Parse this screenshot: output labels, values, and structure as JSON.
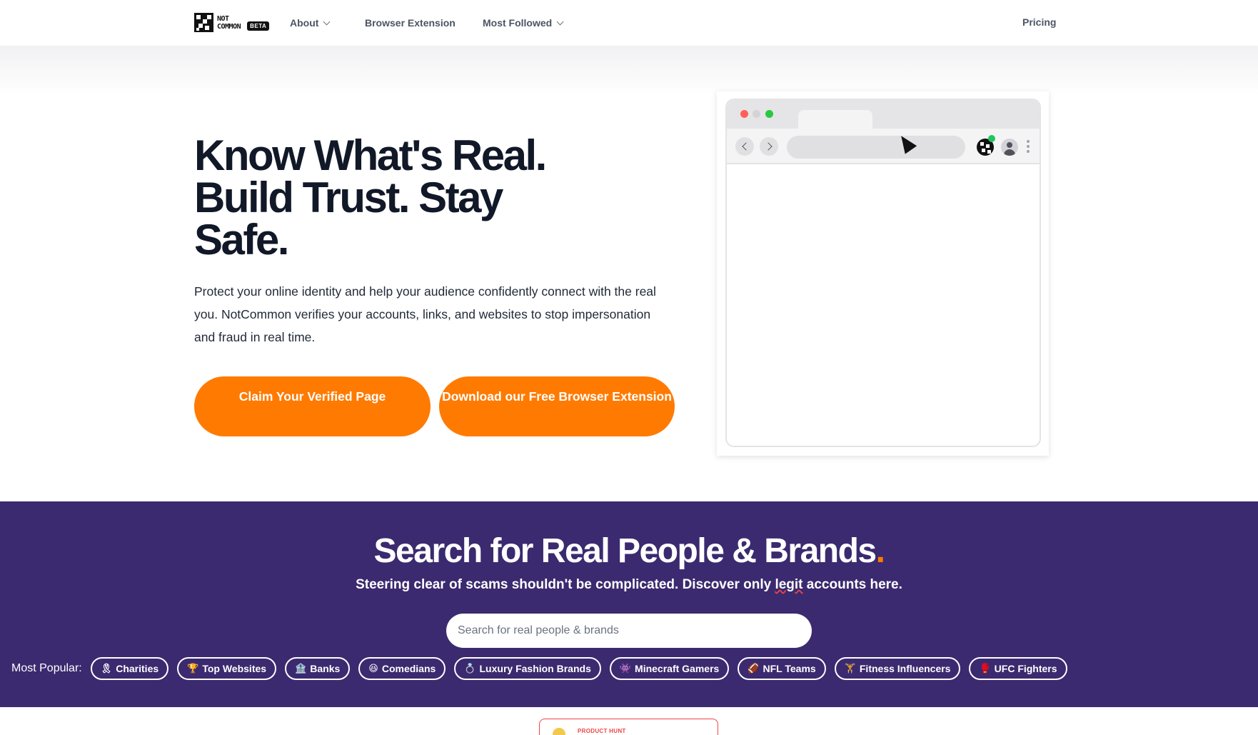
{
  "nav": {
    "logo_line1": "NOT",
    "logo_line2": "COMMON",
    "logo_badge": "BETA",
    "links": [
      {
        "label": "About",
        "icon": "chevron-down-icon"
      },
      {
        "label": "Browser Extension"
      },
      {
        "label": "Most Followed",
        "icon": "chevron-down-icon"
      }
    ],
    "pricing": "Pricing"
  },
  "hero": {
    "title": "Know What's Real. Build Trust. Stay Safe.",
    "description": "Protect your online identity and help your audience confidently connect with the real you. NotCommon verifies your accounts, links, and websites to stop impersonation and fraud in real time.",
    "cta_primary": "Claim Your Verified Page",
    "cta_secondary": "Download our Free Browser Extension"
  },
  "search": {
    "title": "Search for Real People & Brands",
    "title_accent": ".",
    "subtitle_before": "Steering clear of scams shouldn't be complicated. Discover only ",
    "subtitle_legit": "legit",
    "subtitle_after": " accounts here.",
    "placeholder": "Search for real people & brands",
    "popular_label": "Most Popular:",
    "categories": [
      {
        "emoji": "🎗",
        "label": "Charities"
      },
      {
        "emoji": "🏆",
        "label": "Top Websites"
      },
      {
        "emoji": "🏦",
        "label": "Banks"
      },
      {
        "emoji": "😆",
        "label": "Comedians"
      },
      {
        "emoji": "💍",
        "label": "Luxury Fashion Brands"
      },
      {
        "emoji": "👾",
        "label": "Minecraft Gamers"
      },
      {
        "emoji": "🏈",
        "label": "NFL Teams"
      },
      {
        "emoji": "🏋",
        "label": "Fitness Influencers"
      },
      {
        "emoji": "🥊",
        "label": "UFC Fighters"
      }
    ]
  },
  "product_hunt": {
    "label": "PRODUCT HUNT"
  },
  "colors": {
    "accent": "#ff7a00",
    "section_bg": "#3b2a6f",
    "heading": "#111827"
  }
}
